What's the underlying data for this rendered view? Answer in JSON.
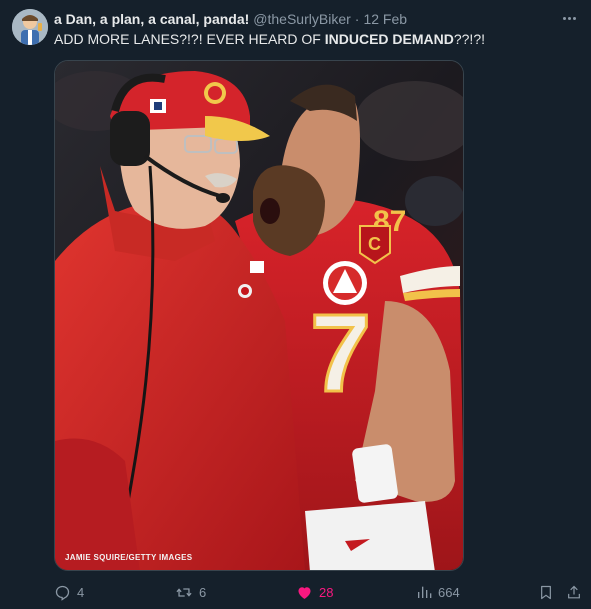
{
  "tweet": {
    "display_name": "a Dan, a plan, a canal, panda!",
    "handle": "@theSurlyBiker",
    "separator": "·",
    "date": "12 Feb",
    "text_part1": "ADD MORE LANES?!?! EVER HEARD OF ",
    "text_bold": "INDUCED DEMAND",
    "text_part2": "??!?!",
    "photo_credit": "JAMIE SQUIRE/GETTY IMAGES"
  },
  "actions": {
    "replies": "4",
    "retweets": "6",
    "likes": "28",
    "views": "664"
  },
  "icons": {
    "more": "more-horizontal-icon",
    "reply": "reply-icon",
    "retweet": "retweet-icon",
    "like": "heart-icon",
    "views": "views-chart-icon",
    "bookmark": "bookmark-icon",
    "share": "share-icon"
  },
  "colors": {
    "background": "#15202b",
    "text": "#e7e9ea",
    "muted": "#8b98a5",
    "like_active": "#f91880"
  }
}
